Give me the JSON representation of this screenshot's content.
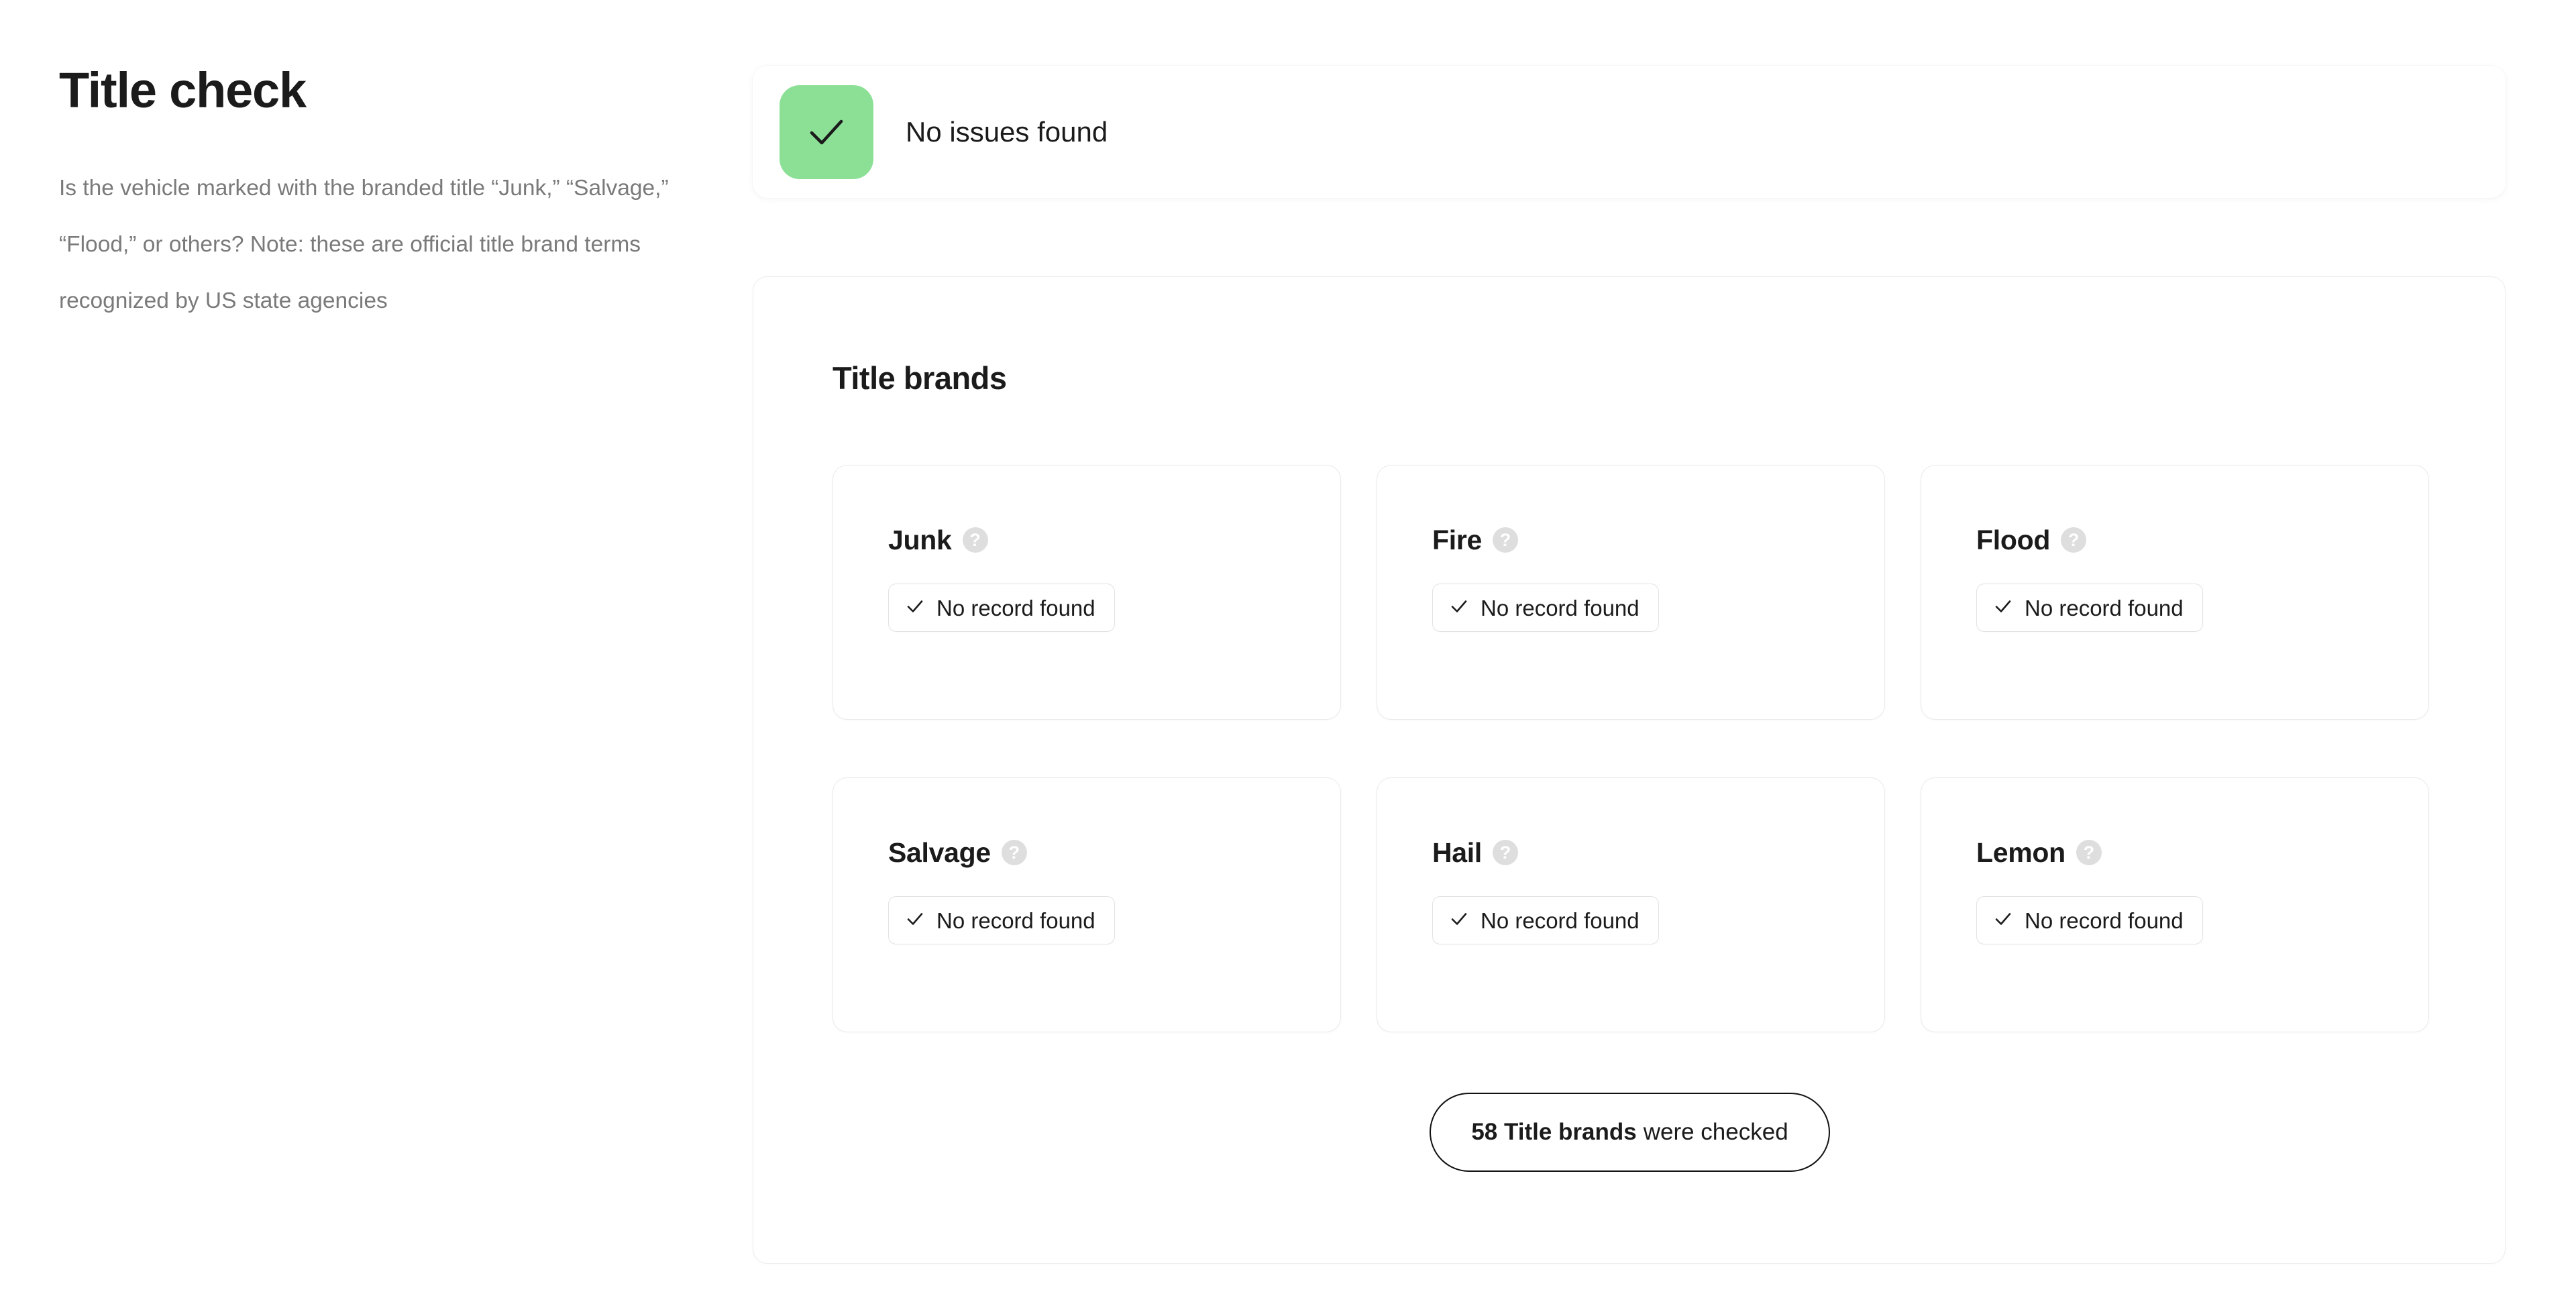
{
  "section": {
    "title": "Title check",
    "description": "Is the vehicle marked with the branded title “Junk,” “Salvage,” “Flood,” or others? Note: these are official title brand terms recognized by US state agencies"
  },
  "status_banner": {
    "icon": "check-icon",
    "label": "No issues found",
    "badge_color": "#8ce096"
  },
  "panel": {
    "title": "Title brands",
    "cards": [
      {
        "name": "Junk",
        "help": "?",
        "status": "No record found",
        "status_icon": "check-icon"
      },
      {
        "name": "Fire",
        "help": "?",
        "status": "No record found",
        "status_icon": "check-icon"
      },
      {
        "name": "Flood",
        "help": "?",
        "status": "No record found",
        "status_icon": "check-icon"
      },
      {
        "name": "Salvage",
        "help": "?",
        "status": "No record found",
        "status_icon": "check-icon"
      },
      {
        "name": "Hail",
        "help": "?",
        "status": "No record found",
        "status_icon": "check-icon"
      },
      {
        "name": "Lemon",
        "help": "?",
        "status": "No record found",
        "status_icon": "check-icon"
      }
    ],
    "summary": {
      "count_label": "58 Title brands",
      "rest_label": "were checked"
    }
  },
  "colors": {
    "text_primary": "#1b1b1b",
    "text_muted": "#7a7a7a",
    "border": "#e9e9e9",
    "success": "#8ce096",
    "help_bg": "#dedede"
  }
}
